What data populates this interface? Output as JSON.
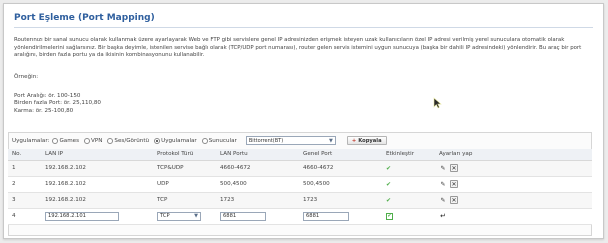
{
  "page": {
    "title": "Port Eşleme (Port Mapping)",
    "description": "Routerınızı bir sanal sunucu olarak kullanmak üzere ayarlayarak Web ve FTP gibi servislere genel IP adresinizden erişmek isteyen uzak kullanıcıların özel IP adresi verilmiş yerel sunuculara otomatik olarak yönlendirilmelerini sağlarsınız. Bir başka deyimle, istenilen servise bağlı olarak (TCP/UDP port numarası), router gelen servis istemini uygun sunucuya (başka bir dahili IP adresindeki) yönlendirir. Bu araç bir port aralığını, birden fazla portu ya da ikisinin kombinasyonunu kullanabilir.",
    "example_heading": "Örneğin:",
    "examples": [
      "Port Aralığı: ör. 100-150",
      "Birden fazla Port: ör. 25,110,80",
      "Karma: ör. 25-100,80"
    ]
  },
  "filter": {
    "label": "Uygulamalar:",
    "options": [
      {
        "label": "Games",
        "checked": false
      },
      {
        "label": "VPN",
        "checked": false
      },
      {
        "label": "Ses/Görüntü",
        "checked": false
      },
      {
        "label": "Uygulamalar",
        "checked": true
      },
      {
        "label": "Sunucular",
        "checked": false
      }
    ],
    "selected_app": "Bittorrent(BT)",
    "copy_button": "Kopyala"
  },
  "table": {
    "headers": [
      "No.",
      "LAN IP",
      "Protokol Türü",
      "LAN Portu",
      "Genel Port",
      "Etkinleştir",
      "Ayarları yap"
    ],
    "rows": [
      {
        "no": "1",
        "ip": "192.168.2.102",
        "protocol": "TCP&UDP",
        "lan_port": "4660-4672",
        "public_port": "4660-4672"
      },
      {
        "no": "2",
        "ip": "192.168.2.102",
        "protocol": "UDP",
        "lan_port": "500,4500",
        "public_port": "500,4500"
      },
      {
        "no": "3",
        "ip": "192.168.2.102",
        "protocol": "TCP",
        "lan_port": "1723",
        "public_port": "1723"
      }
    ],
    "new_row": {
      "no": "4",
      "ip": "192.168.2.101",
      "protocol": "TCP",
      "lan_port": "6881",
      "public_port": "6881"
    }
  },
  "icons": {
    "enabled": "check-icon",
    "edit": "pencil-icon",
    "delete": "delete-x-icon",
    "add": "enter-icon"
  },
  "colors": {
    "title": "#2f5f9e",
    "check": "#4fae4a",
    "header_bg": "#eef1f5"
  }
}
